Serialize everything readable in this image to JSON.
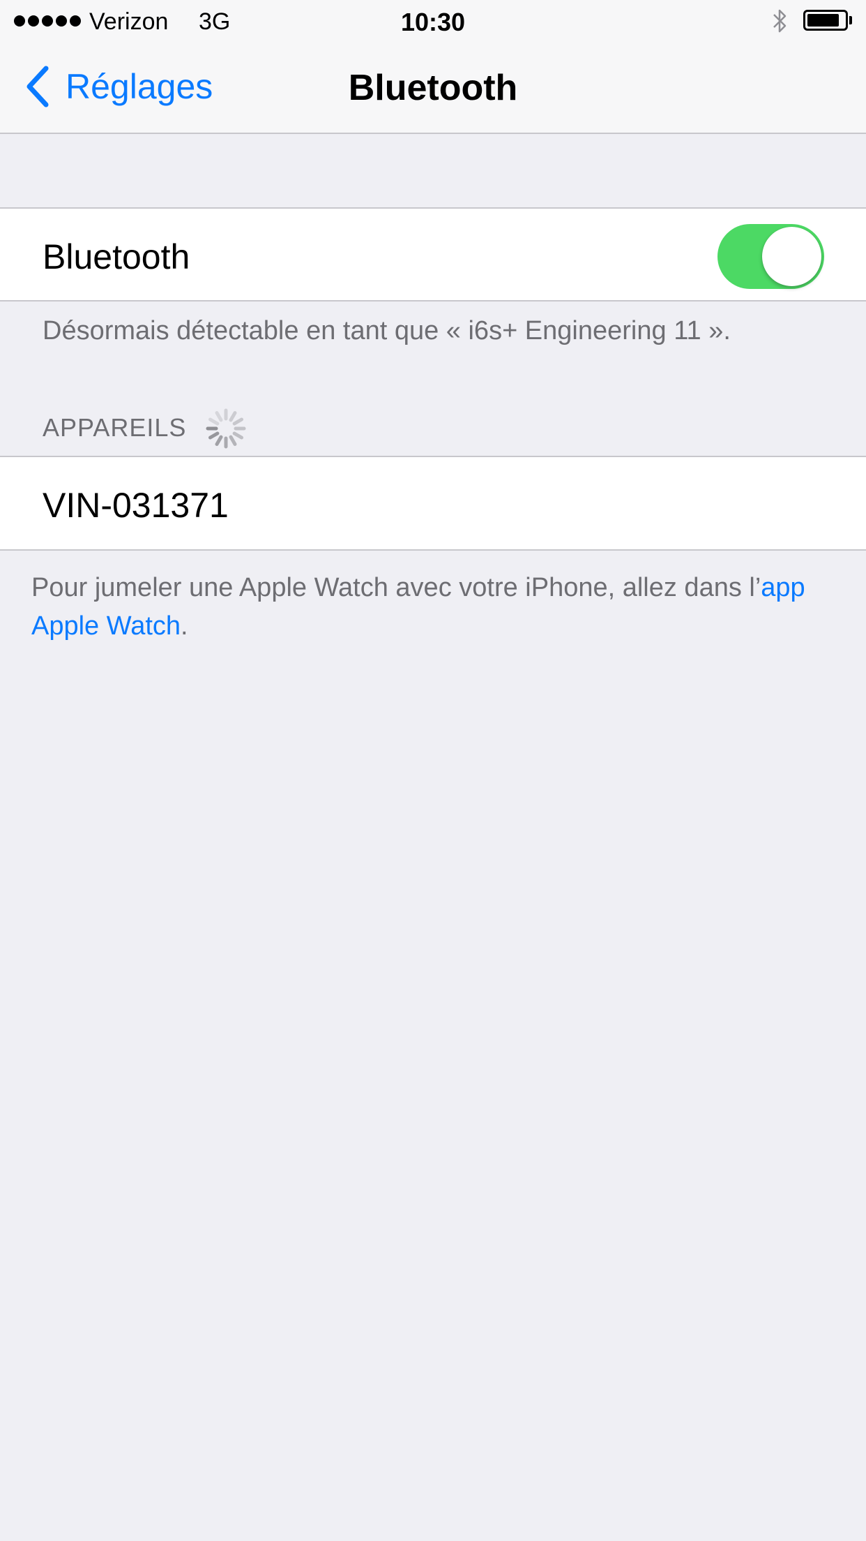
{
  "status_bar": {
    "carrier": "Verizon",
    "network": "3G",
    "time": "10:30",
    "battery_level": 0.86
  },
  "nav": {
    "back_label": "Réglages",
    "title": "Bluetooth"
  },
  "bluetooth_cell": {
    "label": "Bluetooth",
    "toggle_on": true
  },
  "discoverable_note": "Désormais détectable en tant que « i6s+ Engineering 11  ».",
  "devices_section": {
    "header": "APPAREILS",
    "items": [
      {
        "name": "VIN-031371"
      }
    ]
  },
  "watch_note": {
    "prefix": "Pour jumeler une Apple Watch avec votre iPhone, allez dans l’",
    "link": "app Apple Watch",
    "suffix": "."
  },
  "colors": {
    "accent": "#0a7aff",
    "toggle_on": "#4cd964",
    "background": "#efeff4",
    "secondary_text": "#6d6d72"
  },
  "icons": {
    "back": "chevron-left-icon",
    "bluetooth": "bluetooth-icon",
    "spinner": "activity-spinner-icon"
  }
}
